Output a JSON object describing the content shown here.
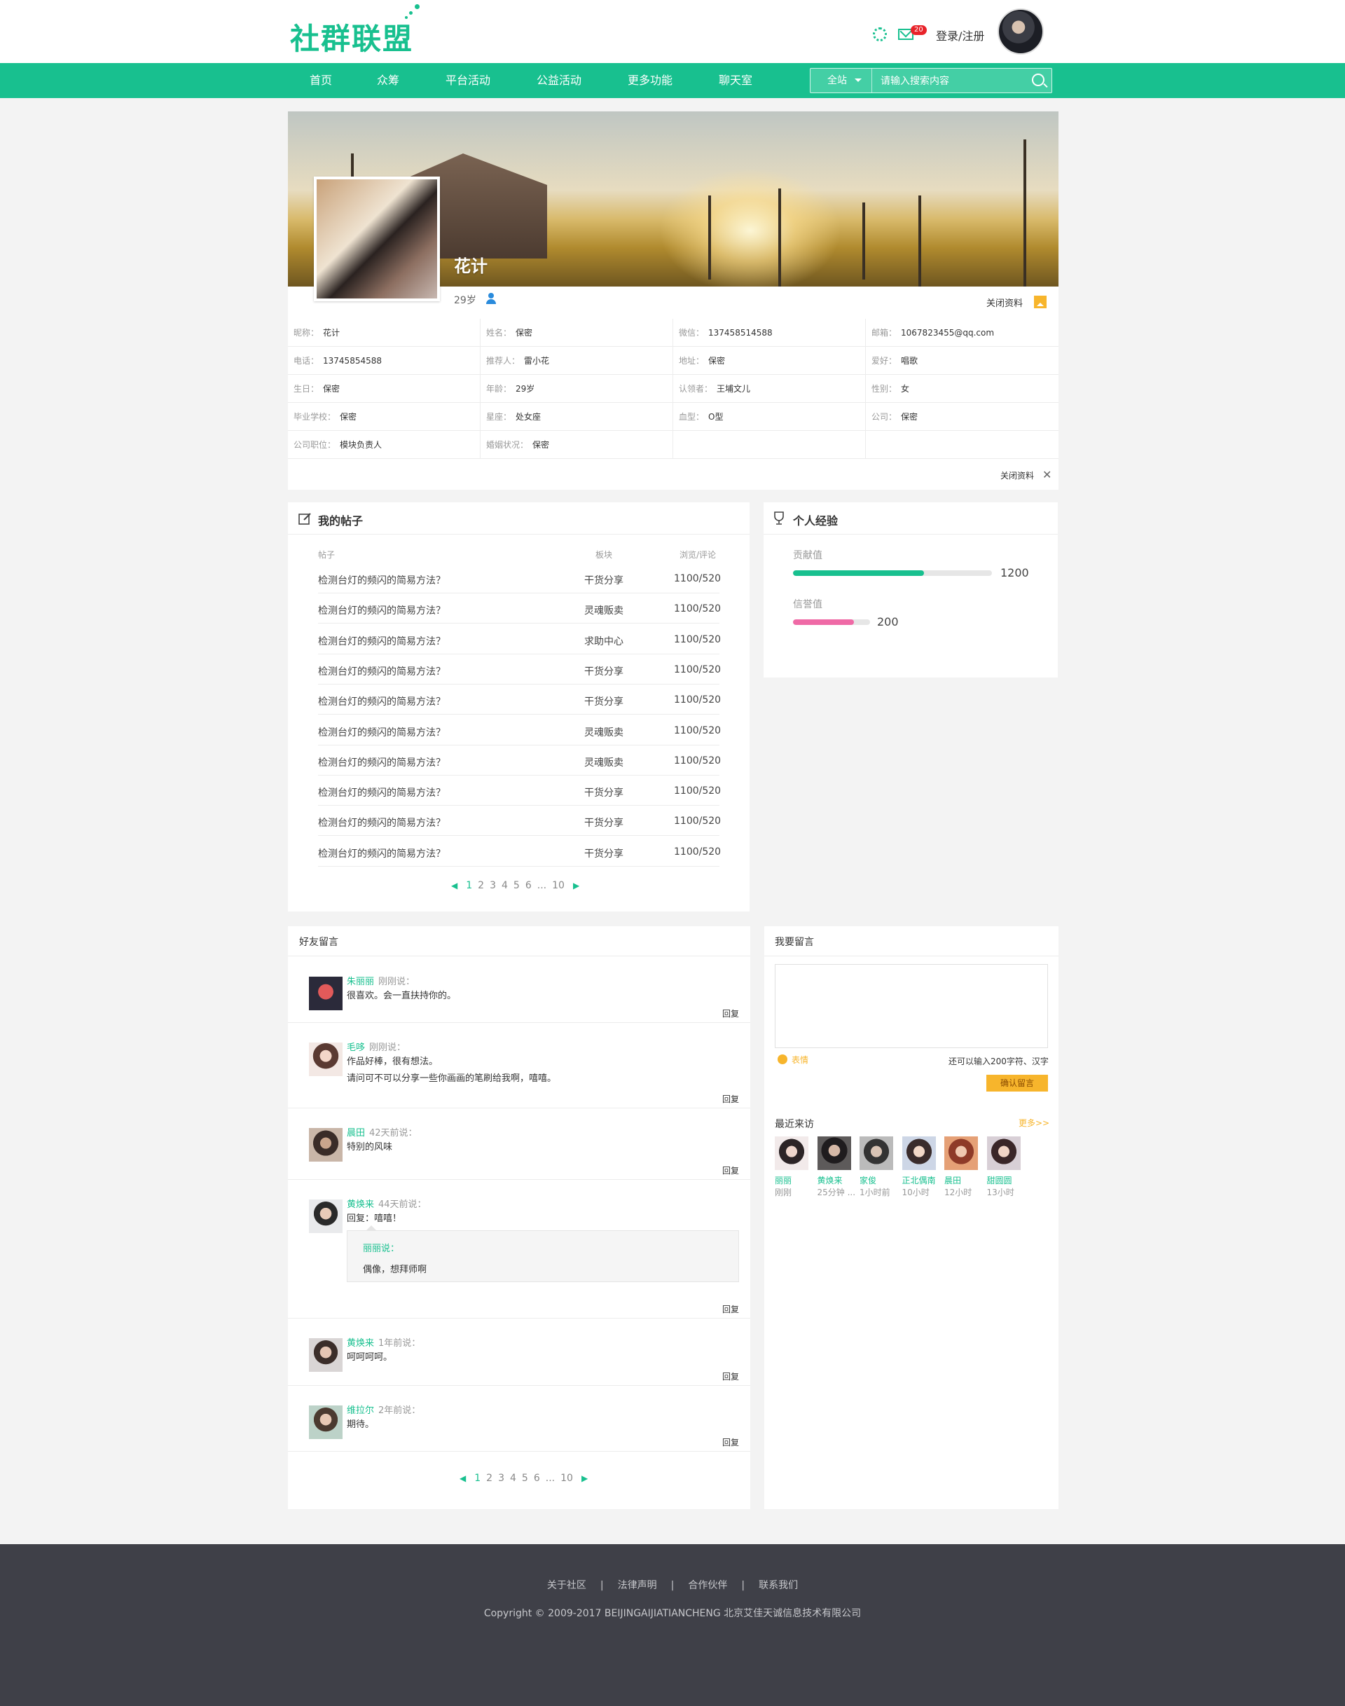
{
  "header": {
    "logo": "社群联盟",
    "mail_count": "20",
    "login": "登录/注册",
    "colors": {
      "brand": "#18c08f",
      "accent": "#f7b52c",
      "badge": "#e8232a"
    }
  },
  "nav": {
    "items": [
      "首页",
      "众筹",
      "平台活动",
      "公益活动",
      "更多功能",
      "聊天室"
    ],
    "search_scope": "全站",
    "search_placeholder": "请输入搜索内容"
  },
  "profile": {
    "name": "花计",
    "age": "29岁",
    "toggle_label": "关闭资料",
    "close_label": "关闭资料",
    "fields": [
      {
        "k": "昵称：",
        "v": "花计"
      },
      {
        "k": "姓名：",
        "v": "保密"
      },
      {
        "k": "微信：",
        "v": "137458514588"
      },
      {
        "k": "邮箱：",
        "v": "1067823455@qq.com"
      },
      {
        "k": "电话：",
        "v": "13745854588"
      },
      {
        "k": "推荐人：",
        "v": "雷小花"
      },
      {
        "k": "地址：",
        "v": "保密"
      },
      {
        "k": "爱好：",
        "v": "唱歌"
      },
      {
        "k": "生日：",
        "v": "保密"
      },
      {
        "k": "年龄：",
        "v": "29岁"
      },
      {
        "k": "认领者：",
        "v": "王埔文儿"
      },
      {
        "k": "性别：",
        "v": "女"
      },
      {
        "k": "毕业学校：",
        "v": "保密"
      },
      {
        "k": "星座：",
        "v": "处女座"
      },
      {
        "k": "血型：",
        "v": "O型"
      },
      {
        "k": "公司：",
        "v": "保密"
      },
      {
        "k": "公司职位：",
        "v": "模块负责人"
      },
      {
        "k": "婚姻状况：",
        "v": "保密"
      },
      {
        "k": "",
        "v": ""
      },
      {
        "k": "",
        "v": ""
      }
    ]
  },
  "posts": {
    "title": "我的帖子",
    "columns": [
      "帖子",
      "板块",
      "浏览/评论"
    ],
    "rows": [
      {
        "title": "检测台灯的频闪的简易方法？",
        "board": "干货分享",
        "stats": "1100/520"
      },
      {
        "title": "检测台灯的频闪的简易方法？",
        "board": "灵魂贩卖",
        "stats": "1100/520"
      },
      {
        "title": "检测台灯的频闪的简易方法？",
        "board": "求助中心",
        "stats": "1100/520"
      },
      {
        "title": "检测台灯的频闪的简易方法？",
        "board": "干货分享",
        "stats": "1100/520"
      },
      {
        "title": "检测台灯的频闪的简易方法？",
        "board": "干货分享",
        "stats": "1100/520"
      },
      {
        "title": "检测台灯的频闪的简易方法？",
        "board": "灵魂贩卖",
        "stats": "1100/520"
      },
      {
        "title": "检测台灯的频闪的简易方法？",
        "board": "灵魂贩卖",
        "stats": "1100/520"
      },
      {
        "title": "检测台灯的频闪的简易方法？",
        "board": "干货分享",
        "stats": "1100/520"
      },
      {
        "title": "检测台灯的频闪的简易方法？",
        "board": "干货分享",
        "stats": "1100/520"
      },
      {
        "title": "检测台灯的频闪的简易方法？",
        "board": "干货分享",
        "stats": "1100/520"
      }
    ],
    "pages": [
      "1",
      "2",
      "3",
      "4",
      "5",
      "6",
      "...",
      "10"
    ]
  },
  "experience": {
    "title": "个人经验",
    "contribution_label": "贡献值",
    "contribution_value": "1200",
    "contribution_fill": 0.66,
    "credit_label": "信誉值",
    "credit_value": "200",
    "credit_fill": 0.79
  },
  "messages": {
    "title": "好友留言",
    "reply_label": "回复",
    "items": [
      {
        "name": "朱丽丽",
        "time": "刚刚说：",
        "lines": [
          "很喜欢。会一直扶持你的。"
        ]
      },
      {
        "name": "毛哆",
        "time": "刚刚说：",
        "lines": [
          "作品好棒，很有想法。",
          "请问可不可以分享一些你画画的笔刷给我啊，嘻嘻。"
        ]
      },
      {
        "name": "晨田",
        "time": "42天前说：",
        "lines": [
          "特别的风味"
        ]
      },
      {
        "name": "黄焕来",
        "time": "44天前说：",
        "lines": [
          "回复：嘻嘻！"
        ],
        "quote_name": "丽丽说：",
        "quote_text": "偶像，想拜师啊"
      },
      {
        "name": "黄焕来",
        "time": "1年前说：",
        "lines": [
          "呵呵呵呵。"
        ]
      },
      {
        "name": "维拉尔",
        "time": "2年前说：",
        "lines": [
          "期待。"
        ]
      }
    ],
    "pages": [
      "1",
      "2",
      "3",
      "4",
      "5",
      "6",
      "...",
      "10"
    ]
  },
  "leave": {
    "title": "我要留言",
    "emoji_label": "表情",
    "count_text": "还可以输入200字符、汉字",
    "confirm": "确认留言"
  },
  "visitors": {
    "title": "最近来访",
    "more": "更多>>",
    "items": [
      {
        "name": "丽丽",
        "time": "刚刚"
      },
      {
        "name": "黄焕来",
        "time": "25分钟 ..."
      },
      {
        "name": "家俊",
        "time": "1小时前"
      },
      {
        "name": "正北偶南",
        "time": "10小时"
      },
      {
        "name": "晨田",
        "time": "12小时"
      },
      {
        "name": "甜圆圆",
        "time": "13小时"
      }
    ]
  },
  "footer": {
    "links": [
      "关于社区",
      "法律声明",
      "合作伙伴",
      "联系我们"
    ],
    "copyright": "Copyright © 2009-2017 BEIJINGAIJIATIANCHENG 北京艾佳天诚信息技术有限公司"
  }
}
